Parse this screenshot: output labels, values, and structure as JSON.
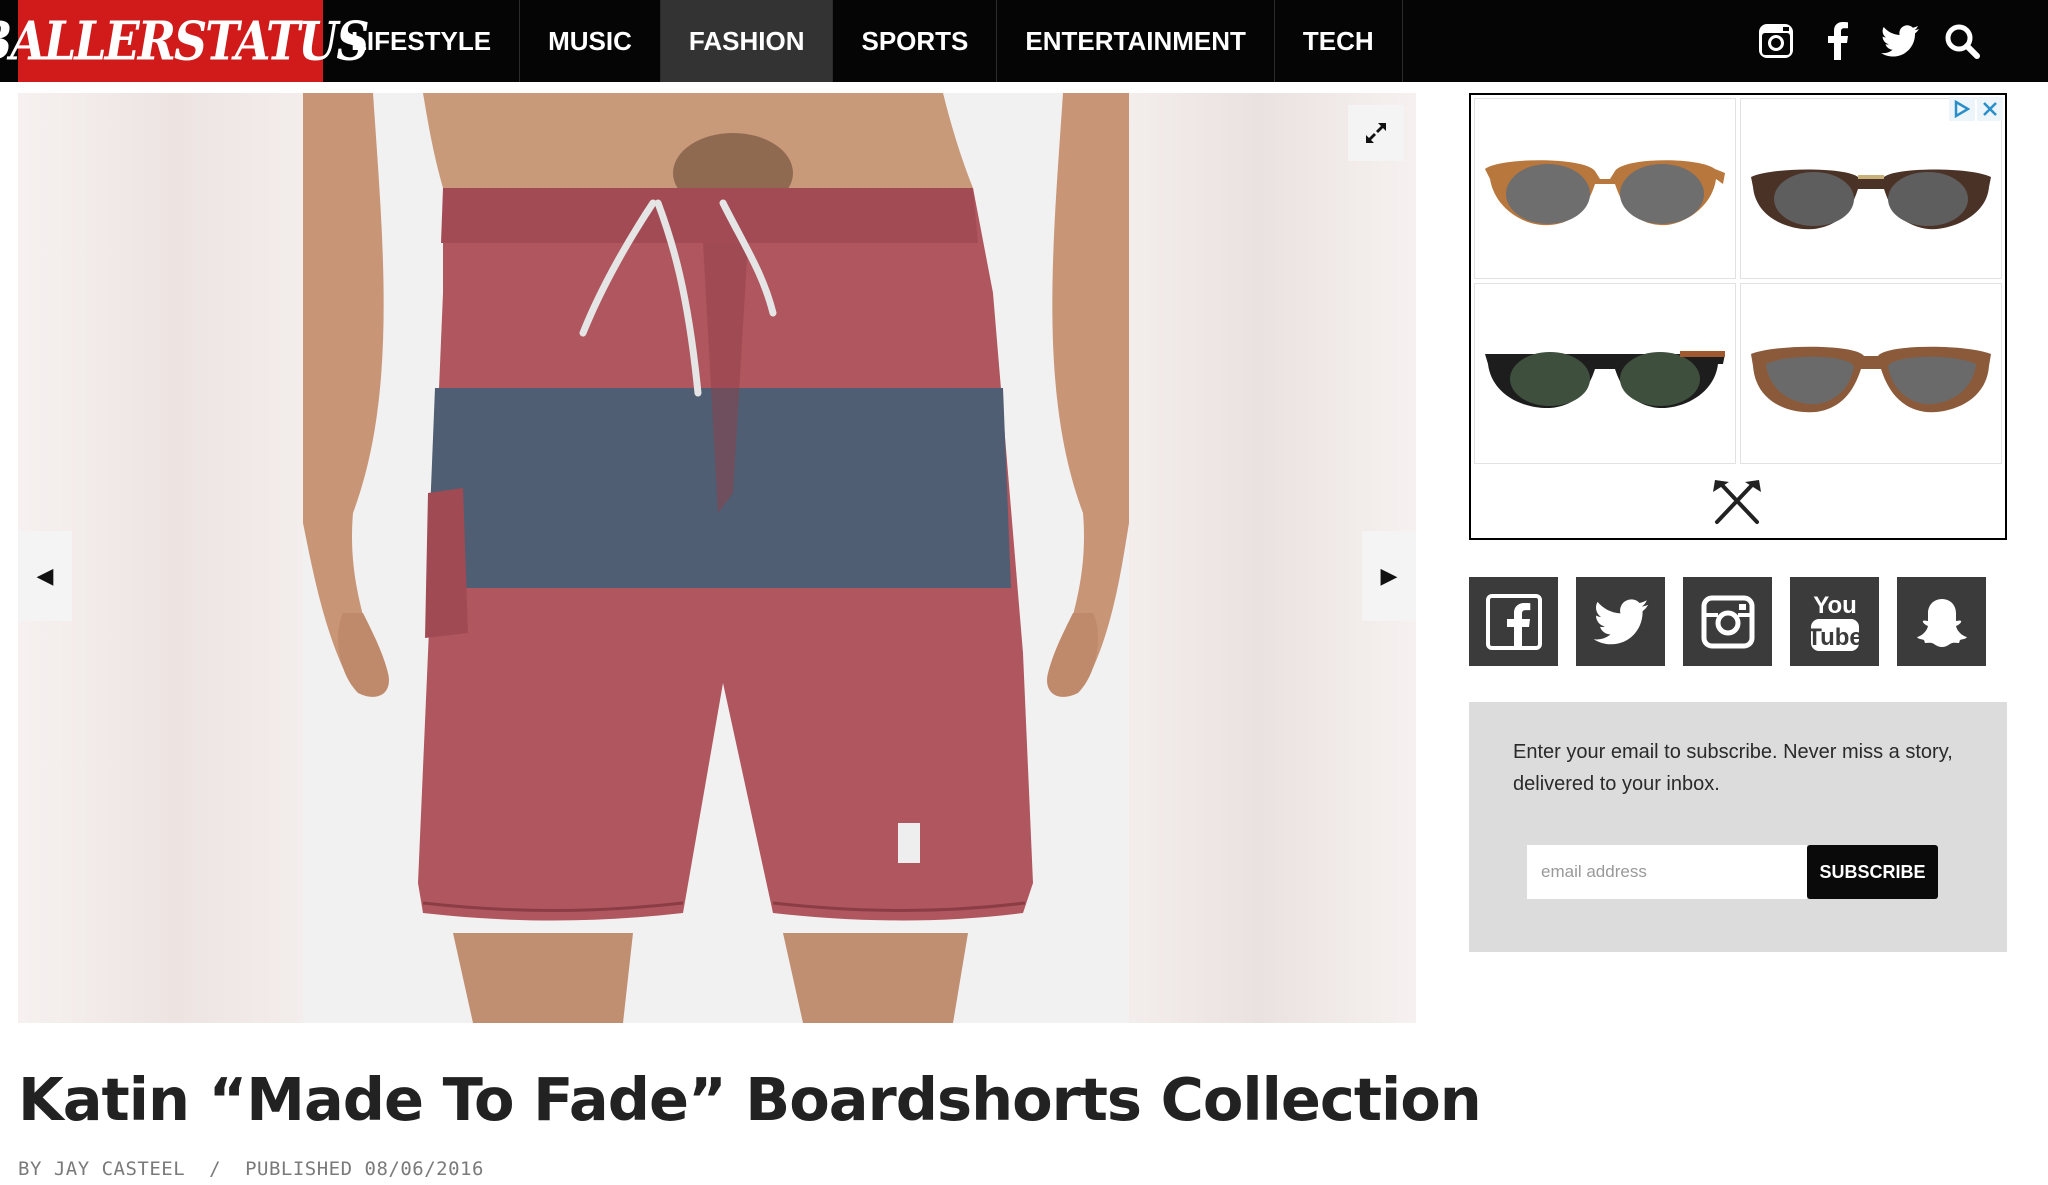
{
  "header": {
    "logo_text": "BALLERSTATUS",
    "nav": [
      {
        "label": "LIFESTYLE"
      },
      {
        "label": "MUSIC"
      },
      {
        "label": "FASHION"
      },
      {
        "label": "SPORTS"
      },
      {
        "label": "ENTERTAINMENT"
      },
      {
        "label": "TECH"
      }
    ],
    "active_nav": "FASHION",
    "icons": [
      "instagram-icon",
      "facebook-icon",
      "twitter-icon",
      "search-icon"
    ]
  },
  "slideshow": {
    "prev_icon": "◀",
    "next_icon": "▶",
    "expand_icon": "expand-icon",
    "colors": {
      "shorts_red": "#b0565e",
      "shorts_stripe": "#4f5e72",
      "skin": "#c99a7a"
    }
  },
  "article": {
    "title": "Katin “Made To Fade” Boardshorts Collection",
    "author": "BY JAY CASTEEL",
    "separator": "/",
    "published": "PUBLISHED 08/06/2016"
  },
  "ad": {
    "products": [
      "wood-sunglasses-1",
      "wood-sunglasses-2",
      "black-sunglasses",
      "wood-aviator-sunglasses"
    ],
    "badges": [
      "adchoices-icon",
      "close-icon"
    ],
    "brand_icon": "crossed-axes-icon"
  },
  "social_squares": [
    "facebook-icon",
    "twitter-icon",
    "instagram-icon",
    "youtube-icon",
    "snapchat-icon"
  ],
  "subscribe": {
    "text": "Enter your email to subscribe. Never miss a story, delivered to your inbox.",
    "placeholder": "email address",
    "button": "SUBSCRIBE"
  },
  "colors": {
    "brand_red": "#d11b1b",
    "nav_bg": "#050505",
    "nav_active": "#333333"
  }
}
